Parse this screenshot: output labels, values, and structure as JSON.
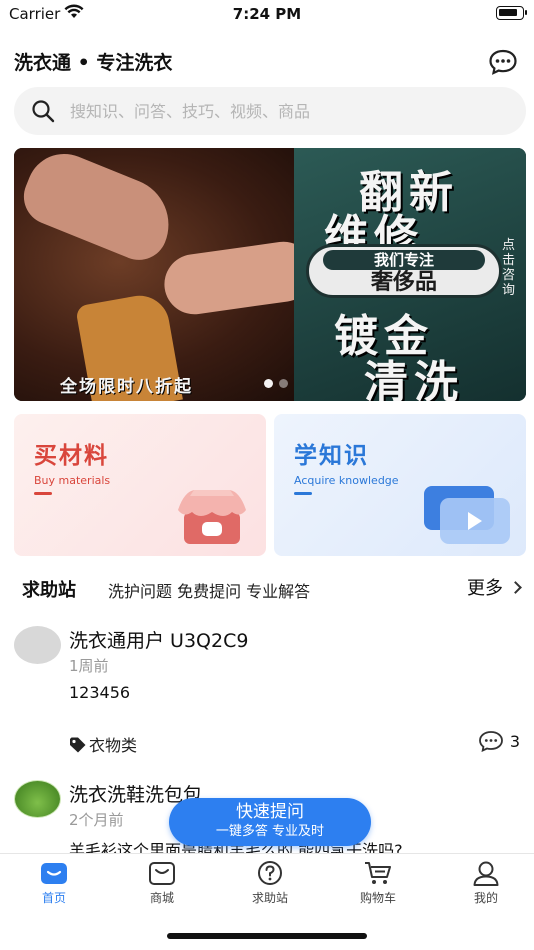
{
  "status_bar": {
    "carrier": "Carrier",
    "time": "7:24 PM"
  },
  "header": {
    "title": "洗衣通 • 专注洗衣",
    "message_icon": "chat-bubble-icon"
  },
  "search": {
    "placeholder": "搜知识、问答、技巧、视频、商品",
    "icon": "search-icon"
  },
  "banner": {
    "line1": "翻新",
    "line2": "维修",
    "pill_top": "我们专注",
    "pill_bottom": "奢侈品",
    "side_text": "点击咨询",
    "line3": "镀金",
    "line4": "清洗",
    "promo": "全场限时八折起",
    "slides_count": 2,
    "active_slide": 1
  },
  "cards": {
    "buy": {
      "title": "买材料",
      "subtitle": "Buy materials",
      "color": "#d9463c"
    },
    "learn": {
      "title": "学知识",
      "subtitle": "Acquire knowledge",
      "color": "#2b78d8"
    }
  },
  "help": {
    "title": "求助站",
    "subtitle": "洗护问题 免费提问 专业解答",
    "more": "更多"
  },
  "posts": [
    {
      "user": "洗衣通用户 U3Q2C9",
      "time": "1周前",
      "content": "123456",
      "tag": "衣物类",
      "comments": "3"
    },
    {
      "user": "洗衣洗鞋洗包包",
      "time": "2个月前",
      "content": "羊毛衫这个里面是腈和羊毛么的,能四氯干洗吗?"
    }
  ],
  "fab": {
    "label": "快速提问",
    "sub": "一键多答 专业及时",
    "color": "#2d7ff0"
  },
  "tabbar": {
    "items": [
      {
        "label": "首页",
        "icon": "home-icon",
        "active": true
      },
      {
        "label": "商城",
        "icon": "shopping-bag-icon"
      },
      {
        "label": "求助站",
        "icon": "help-icon"
      },
      {
        "label": "购物车",
        "icon": "cart-icon"
      },
      {
        "label": "我的",
        "icon": "profile-icon"
      }
    ]
  }
}
